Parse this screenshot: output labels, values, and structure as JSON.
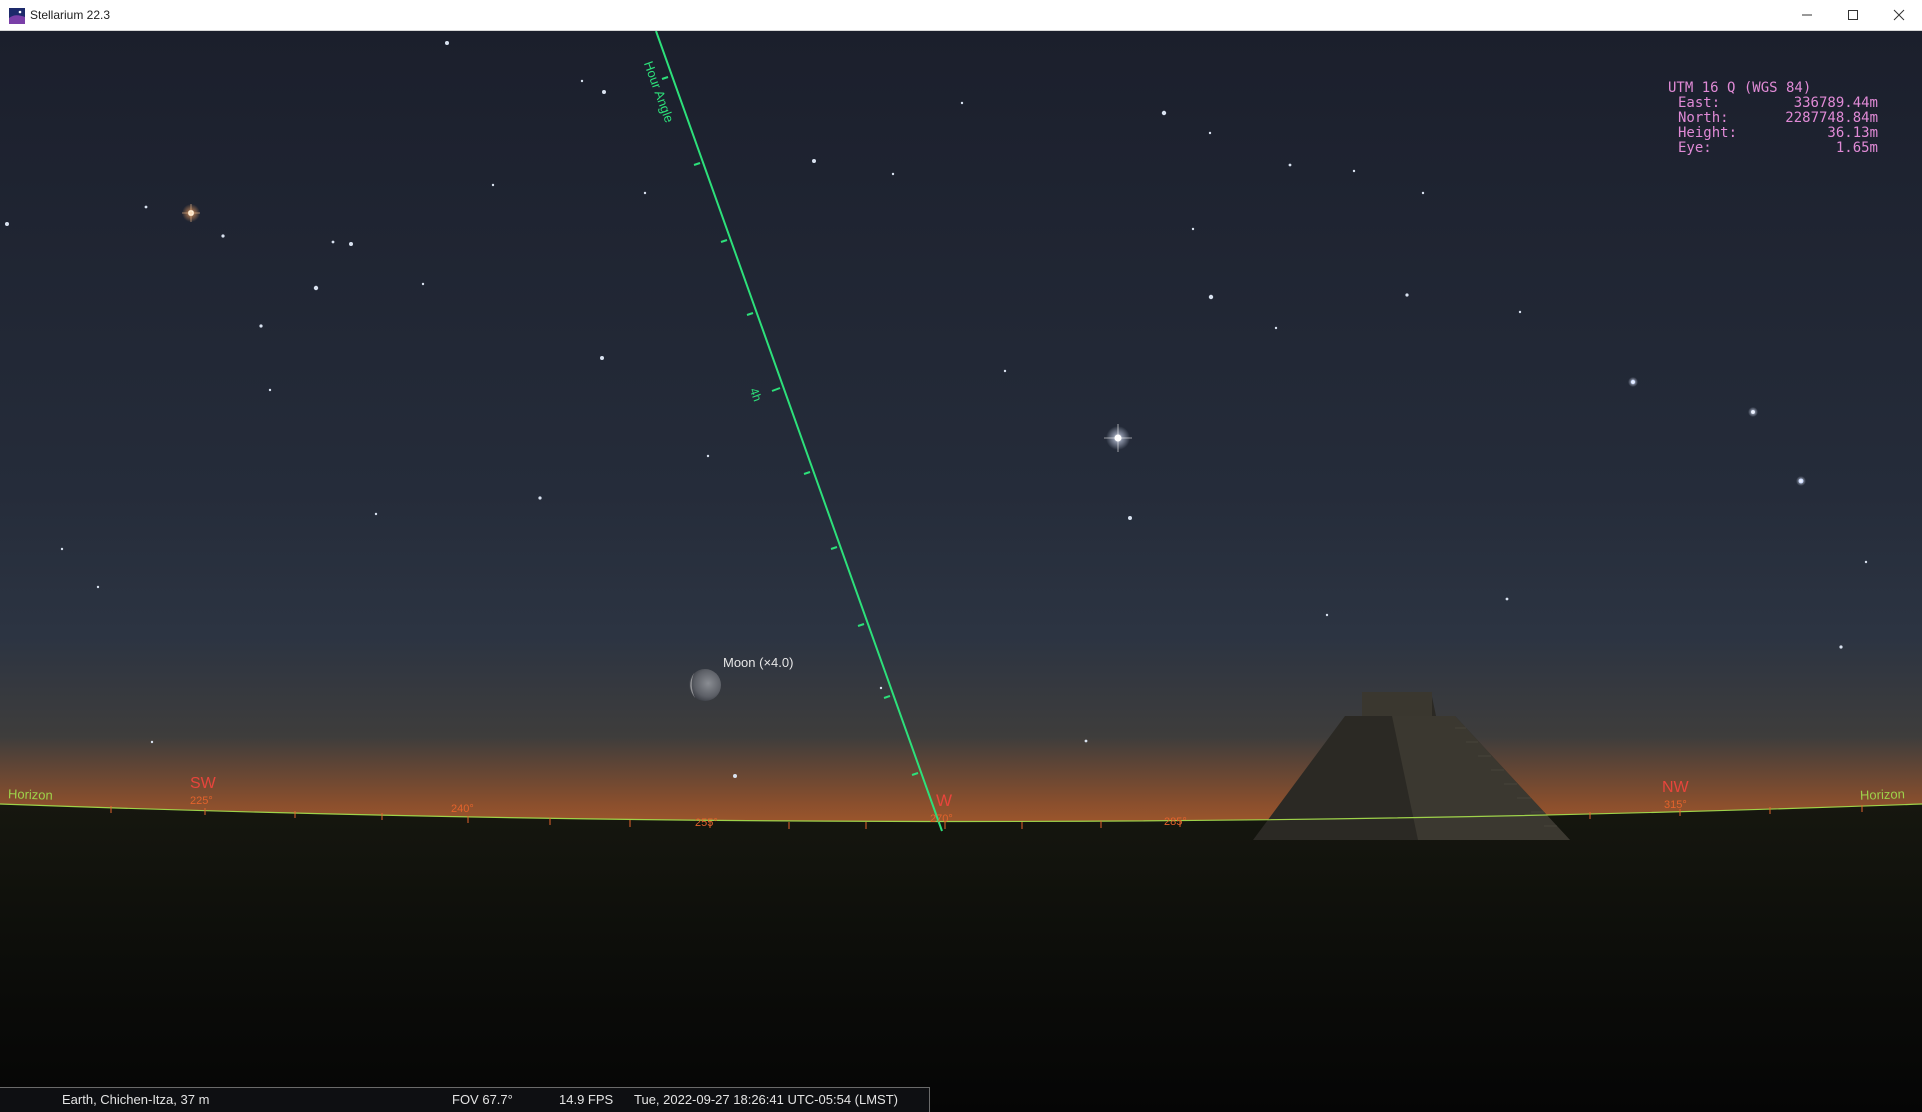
{
  "window": {
    "title": "Stellarium 22.3",
    "controls": [
      "minimize-icon",
      "maximize-icon",
      "close-icon"
    ]
  },
  "sky": {
    "great_circle_label": "Hour Angle",
    "great_circle_tick": "4h",
    "horizon_label_left": "Horizon",
    "horizon_label_right": "Horizon",
    "cardinals": [
      {
        "name": "SW",
        "azimuth": "225°"
      },
      {
        "name": "W",
        "azimuth": "270°"
      },
      {
        "name": "NW",
        "azimuth": "315°"
      }
    ],
    "azimuth_marks": [
      "240°",
      "255°",
      "285°"
    ],
    "moon_label": "Moon (×4.0)",
    "landscape": "pyramid-silhouette"
  },
  "utm": {
    "header": "UTM 16 Q (WGS 84)",
    "rows": [
      {
        "label": "East:",
        "value": "336789.44m"
      },
      {
        "label": "North:",
        "value": "2287748.84m"
      },
      {
        "label": "Height:",
        "value": "36.13m"
      },
      {
        "label": "Eye:",
        "value": "1.65m"
      }
    ]
  },
  "status": {
    "location": "Earth, Chichen-Itza, 37 m",
    "fov": "FOV 67.7°",
    "fps": "14.9 FPS",
    "datetime": "Tue, 2022-09-27 18:26:41 UTC-05:54 (LMST)"
  },
  "colors": {
    "sky_top": "#1b1f2c",
    "sky_mid": "#2a3140",
    "twilight_glow": "#c9662a",
    "great_circle": "#2de07a",
    "cardinal": "#e8453c",
    "azimuth": "#e3632c",
    "horizon_line": "#9ed24a",
    "utm_text": "#e08ad6"
  }
}
